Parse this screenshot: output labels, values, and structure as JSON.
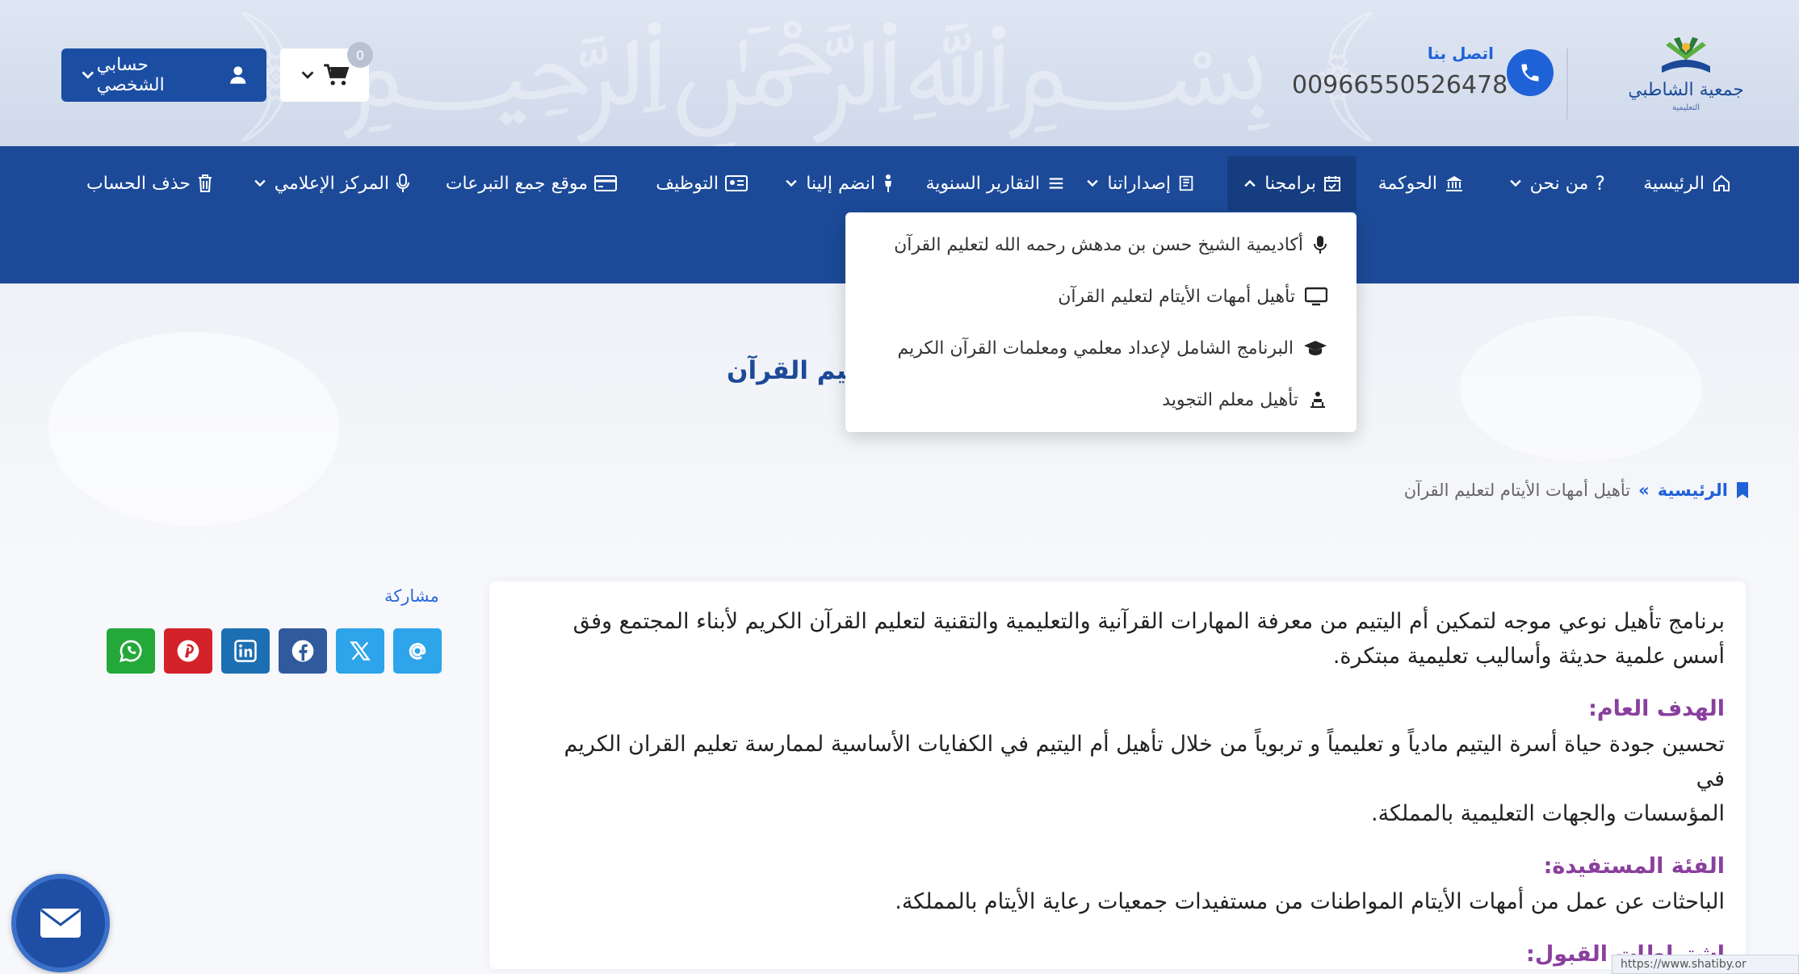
{
  "header": {
    "contact_label": "اتصل بنا",
    "contact_phone": "00966550526478",
    "account_label": "حسابي الشخصي",
    "cart_count": "0"
  },
  "nav": {
    "items": [
      {
        "label": "الرئيسية",
        "icon": "home-icon"
      },
      {
        "label": "من نحن",
        "icon": "question-icon"
      },
      {
        "label": "الحوكمة",
        "icon": "bank-icon"
      },
      {
        "label": "برامجنا",
        "icon": "calendar-check-icon"
      },
      {
        "label": "إصداراتنا",
        "icon": "book-icon"
      },
      {
        "label": "التقارير السنوية",
        "icon": "list-icon"
      },
      {
        "label": "انضم إلينا",
        "icon": "person-icon"
      },
      {
        "label": "التوظيف",
        "icon": "id-card-icon"
      },
      {
        "label": "موقع جمع التبرعات",
        "icon": "credit-card-icon"
      },
      {
        "label": "المركز الإعلامي",
        "icon": "microphone-icon"
      },
      {
        "label": "حذف الحساب",
        "icon": "trash-icon"
      }
    ]
  },
  "dropdown": {
    "items": [
      {
        "label": "أكاديمية الشيخ حسن بن مدهش رحمه الله لتعليم القرآن",
        "icon": "microphone-icon"
      },
      {
        "label": "تأهيل أمهات الأيتام لتعليم القرآن",
        "icon": "monitor-icon"
      },
      {
        "label": "البرنامج الشامل لإعداد معلمي ومعلمات القرآن الكريم",
        "icon": "graduation-cap-icon"
      },
      {
        "label": "تأهيل معلم التجويد",
        "icon": "teacher-icon"
      }
    ]
  },
  "hero": {
    "title_visible": "عليم القرآن"
  },
  "breadcrumb": {
    "home": "الرئيسية",
    "separator": "»",
    "current": "تأهيل أمهات الأيتام لتعليم القرآن"
  },
  "content": {
    "intro_line1": "برنامج تأهيل نوعي موجه لتمكين أم اليتيم من معرفة المهارات القرآنية والتعليمية والتقنية لتعليم القرآن الكريم لأبناء المجتمع وفق",
    "intro_line2": "أسس علمية حديثة وأساليب تعليمية مبتكرة.",
    "goal_heading": "الهدف العام:",
    "goal_line1": "تحسين جودة حياة أسرة اليتيم مادياً و تعليمياً و تربوياً من خلال تأهيل أم اليتيم في الكفايات الأساسية لممارسة تعليم القران الكريم في",
    "goal_line2": "المؤسسات والجهات التعليمية بالمملكة.",
    "target_heading": "الفئة المستفيدة:",
    "target_line1": "الباحثات عن عمل من أمهات الأيتام المواطنات من مستفيدات جمعيات رعاية الأيتام بالمملكة.",
    "admission_heading": "اشتراطات القبول:"
  },
  "share": {
    "label": "مشاركة",
    "buttons": [
      {
        "name": "whatsapp-icon",
        "color": "#25a83a"
      },
      {
        "name": "pinterest-icon",
        "color": "#d3222a"
      },
      {
        "name": "linkedin-icon",
        "color": "#1d6fb3"
      },
      {
        "name": "facebook-icon",
        "color": "#2f5a9e"
      },
      {
        "name": "x-icon",
        "color": "#2ea4ea"
      },
      {
        "name": "email-icon",
        "color": "#2ea4ea"
      }
    ]
  },
  "status_url": "https://www.shatiby.or"
}
